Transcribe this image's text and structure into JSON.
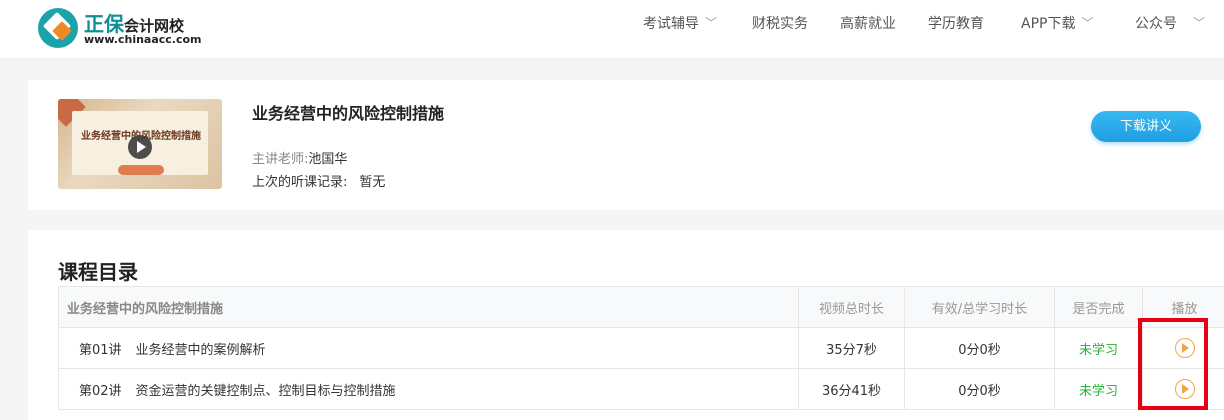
{
  "header": {
    "logo_brand": "正保",
    "logo_sub": "会计网校",
    "logo_url": "www.chinaacc.com",
    "nav": [
      {
        "label": "考试辅导",
        "dropdown": true
      },
      {
        "label": "财税实务",
        "dropdown": false
      },
      {
        "label": "高薪就业",
        "dropdown": false
      },
      {
        "label": "学历教育",
        "dropdown": false
      },
      {
        "label": "APP下载",
        "dropdown": true
      },
      {
        "label": "公众号",
        "dropdown": true
      }
    ]
  },
  "course": {
    "thumb_title": "业务经营中的风险控制措施",
    "title": "业务经营中的风险控制措施",
    "teacher_label": "主讲老师:",
    "teacher_name": "池国华",
    "last_record_label": "上次的听课记录:",
    "last_record_value": "暂无",
    "download_label": "下载讲义"
  },
  "catalog": {
    "title": "课程目录",
    "columns": [
      "业务经营中的风险控制措施",
      "视频总时长",
      "有效/总学习时长",
      "是否完成",
      "播放"
    ],
    "rows": [
      {
        "num": "第01讲",
        "name": "业务经营中的案例解析",
        "duration": "35分7秒",
        "studied": "0分0秒",
        "status": "未学习"
      },
      {
        "num": "第02讲",
        "name": "资金运营的关键控制点、控制目标与控制措施",
        "duration": "36分41秒",
        "studied": "0分0秒",
        "status": "未学习"
      }
    ]
  },
  "colors": {
    "brand_teal": "#1ba3a8",
    "button_blue": "#1e9ee2",
    "status_green": "#27b034",
    "play_orange": "#f2a54a",
    "highlight_red": "#e60012"
  }
}
